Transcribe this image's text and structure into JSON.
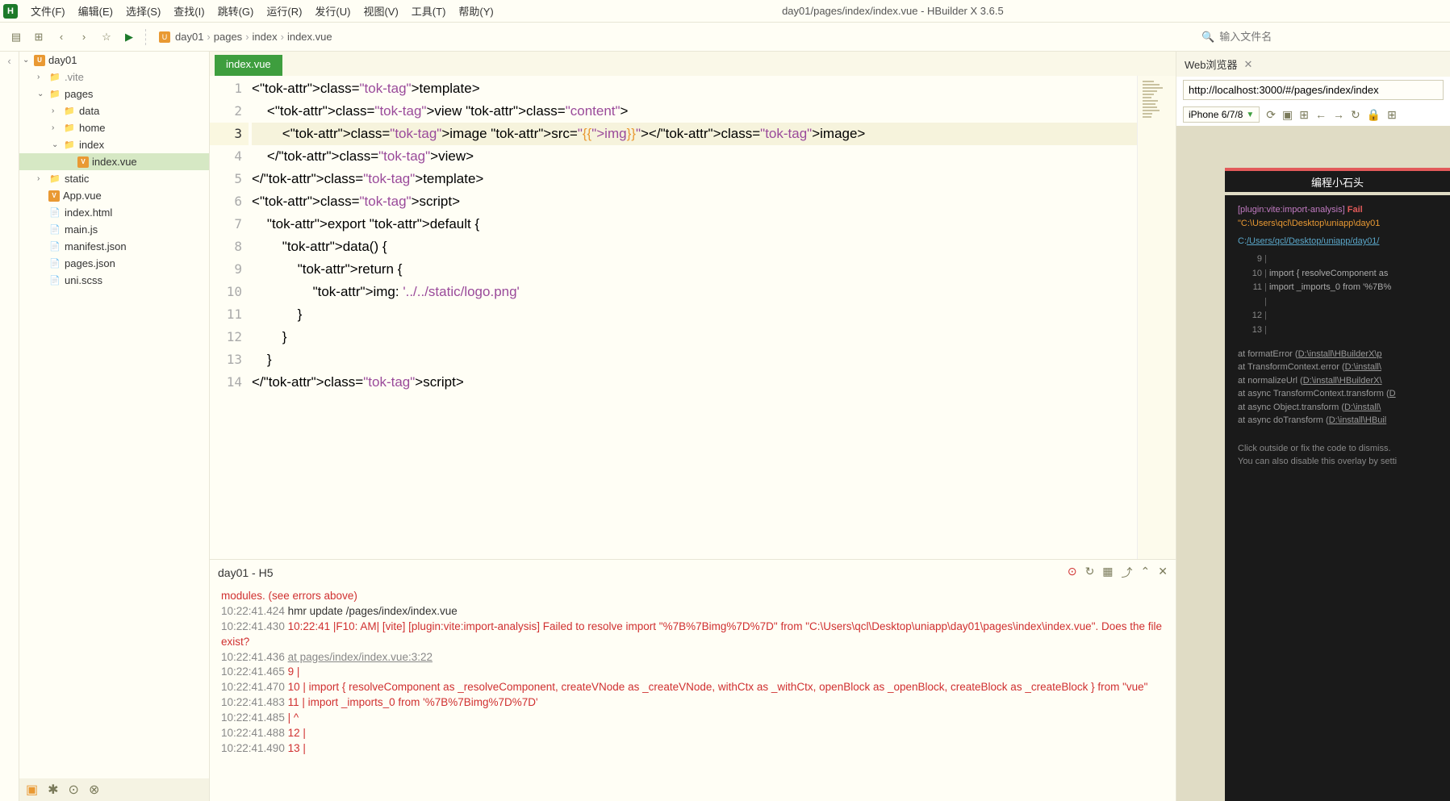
{
  "title": "day01/pages/index/index.vue - HBuilder X 3.6.5",
  "menu": {
    "items": [
      "文件(F)",
      "编辑(E)",
      "选择(S)",
      "查找(I)",
      "跳转(G)",
      "运行(R)",
      "发行(U)",
      "视图(V)",
      "工具(T)",
      "帮助(Y)"
    ]
  },
  "toolbar": {
    "search_placeholder": "输入文件名"
  },
  "breadcrumb": [
    "day01",
    "pages",
    "index",
    "index.vue"
  ],
  "filetree": {
    "root": "day01",
    "items": [
      {
        "depth": 1,
        "chev": "›",
        "icon": "folder",
        "label": ".vite",
        "dim": true
      },
      {
        "depth": 1,
        "chev": "⌄",
        "icon": "folder",
        "label": "pages"
      },
      {
        "depth": 2,
        "chev": "›",
        "icon": "folder",
        "label": "data"
      },
      {
        "depth": 2,
        "chev": "›",
        "icon": "folder",
        "label": "home"
      },
      {
        "depth": 2,
        "chev": "⌄",
        "icon": "folder",
        "label": "index"
      },
      {
        "depth": 3,
        "chev": "",
        "icon": "vue",
        "label": "index.vue",
        "selected": true
      },
      {
        "depth": 1,
        "chev": "›",
        "icon": "folder",
        "label": "static"
      },
      {
        "depth": 1,
        "chev": "",
        "icon": "vue",
        "label": "App.vue"
      },
      {
        "depth": 1,
        "chev": "",
        "icon": "file",
        "label": "index.html"
      },
      {
        "depth": 1,
        "chev": "",
        "icon": "file",
        "label": "main.js"
      },
      {
        "depth": 1,
        "chev": "",
        "icon": "file",
        "label": "manifest.json"
      },
      {
        "depth": 1,
        "chev": "",
        "icon": "file",
        "label": "pages.json"
      },
      {
        "depth": 1,
        "chev": "",
        "icon": "file",
        "label": "uni.scss"
      }
    ]
  },
  "editor": {
    "tab": "index.vue",
    "active_line": 3,
    "lines": [
      "<template>",
      "    <view class=\"content\">",
      "        <image src=\"{{img}}\"></image>",
      "    </view>",
      "</template>",
      "<script>",
      "    export default {",
      "        data() {",
      "            return {",
      "                img: '../../static/logo.png'",
      "            }",
      "        }",
      "    }",
      "</script>"
    ]
  },
  "right_panel": {
    "tab": "Web浏览器",
    "url": "http://localhost:3000/#/pages/index/index",
    "device": "iPhone 6/7/8",
    "app_title": "编程小石头",
    "error": {
      "plugin": "[plugin:vite:import-analysis]",
      "fail": "Fail",
      "path": "\"C:\\Users\\qcl\\Desktop\\uniapp\\day01",
      "link": "/Users/qcl/Desktop/uniapp/day01/",
      "link_prefix": "C:",
      "code_lines": [
        {
          "n": "9",
          "t": ""
        },
        {
          "n": "10",
          "t": "import { resolveComponent as"
        },
        {
          "n": "11",
          "t": "import _imports_0 from '%7B%"
        },
        {
          "n": "",
          "t": ""
        },
        {
          "n": "12",
          "t": ""
        },
        {
          "n": "13",
          "t": ""
        }
      ],
      "stack": [
        "at formatError (D:\\install\\HBuilderX\\p",
        "at TransformContext.error (D:\\install\\",
        "at normalizeUrl (D:\\install\\HBuilderX\\",
        "at async TransformContext.transform (D",
        "at async Object.transform (D:\\install\\",
        "at async doTransform (D:\\install\\HBuil"
      ],
      "dismiss1": "Click outside or fix the code to dismiss.",
      "dismiss2": "You can also disable this overlay by setti"
    }
  },
  "console": {
    "title": "day01 - H5",
    "lines": [
      {
        "cls": "log-red",
        "text": "modules. (see errors above)"
      },
      {
        "cls": "",
        "text": "10:22:41.424 hmr update /pages/index/index.vue"
      },
      {
        "cls": "log-red",
        "text": "10:22:41.430 10:22:41 |F10: AM|  [vite] [plugin:vite:import-analysis] Failed to resolve import \"%7B%7Bimg%7D%7D\" from \"C:\\Users\\qcl\\Desktop\\uniapp\\day01\\pages\\index\\index.vue\". Does the file exist?"
      },
      {
        "cls": "",
        "text": "10:22:41.436 at pages/index/index.vue:3:22",
        "link": true
      },
      {
        "cls": "log-red",
        "text": "10:22:41.465   9  |"
      },
      {
        "cls": "log-red",
        "text": "10:22:41.470  10 |  import { resolveComponent as _resolveComponent, createVNode as _createVNode, withCtx as _withCtx, openBlock as _openBlock, createBlock as _createBlock } from \"vue\""
      },
      {
        "cls": "log-red",
        "text": "10:22:41.483  11 |  import _imports_0 from '%7B%7Bimg%7D%7D'"
      },
      {
        "cls": "log-red",
        "text": "10:22:41.485     |                          ^"
      },
      {
        "cls": "log-red",
        "text": "10:22:41.488  12 |"
      },
      {
        "cls": "log-red",
        "text": "10:22:41.490  13 |"
      }
    ]
  }
}
